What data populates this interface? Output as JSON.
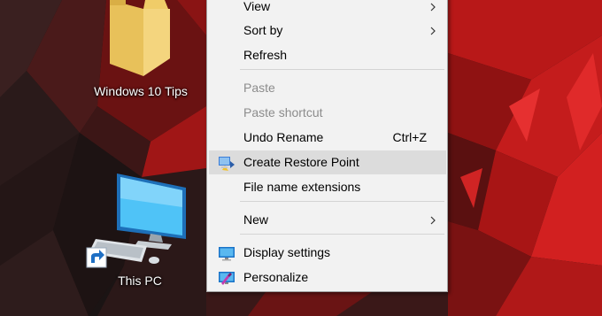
{
  "desktop": {
    "icons": [
      {
        "label": "Windows 10 Tips",
        "icon": "folder-icon"
      },
      {
        "label": "This PC",
        "icon": "computer-icon"
      }
    ]
  },
  "context_menu": {
    "items": [
      {
        "label": "View",
        "submenu": true
      },
      {
        "label": "Sort by",
        "submenu": true
      },
      {
        "label": "Refresh"
      },
      {
        "label": "Paste",
        "disabled": true
      },
      {
        "label": "Paste shortcut",
        "disabled": true
      },
      {
        "label": "Undo Rename",
        "shortcut": "Ctrl+Z"
      },
      {
        "label": "Create Restore Point",
        "icon": "restore-point-icon",
        "highlighted": true
      },
      {
        "label": "File name extensions"
      },
      {
        "label": "New",
        "submenu": true
      },
      {
        "label": "Display settings",
        "icon": "display-settings-icon"
      },
      {
        "label": "Personalize",
        "icon": "personalize-icon"
      }
    ]
  },
  "colors": {
    "menu_background": "#f2f2f2",
    "menu_highlight": "#dcdcdc",
    "disabled_text": "#8c8c8c",
    "wallpaper_red": "#b01818"
  }
}
